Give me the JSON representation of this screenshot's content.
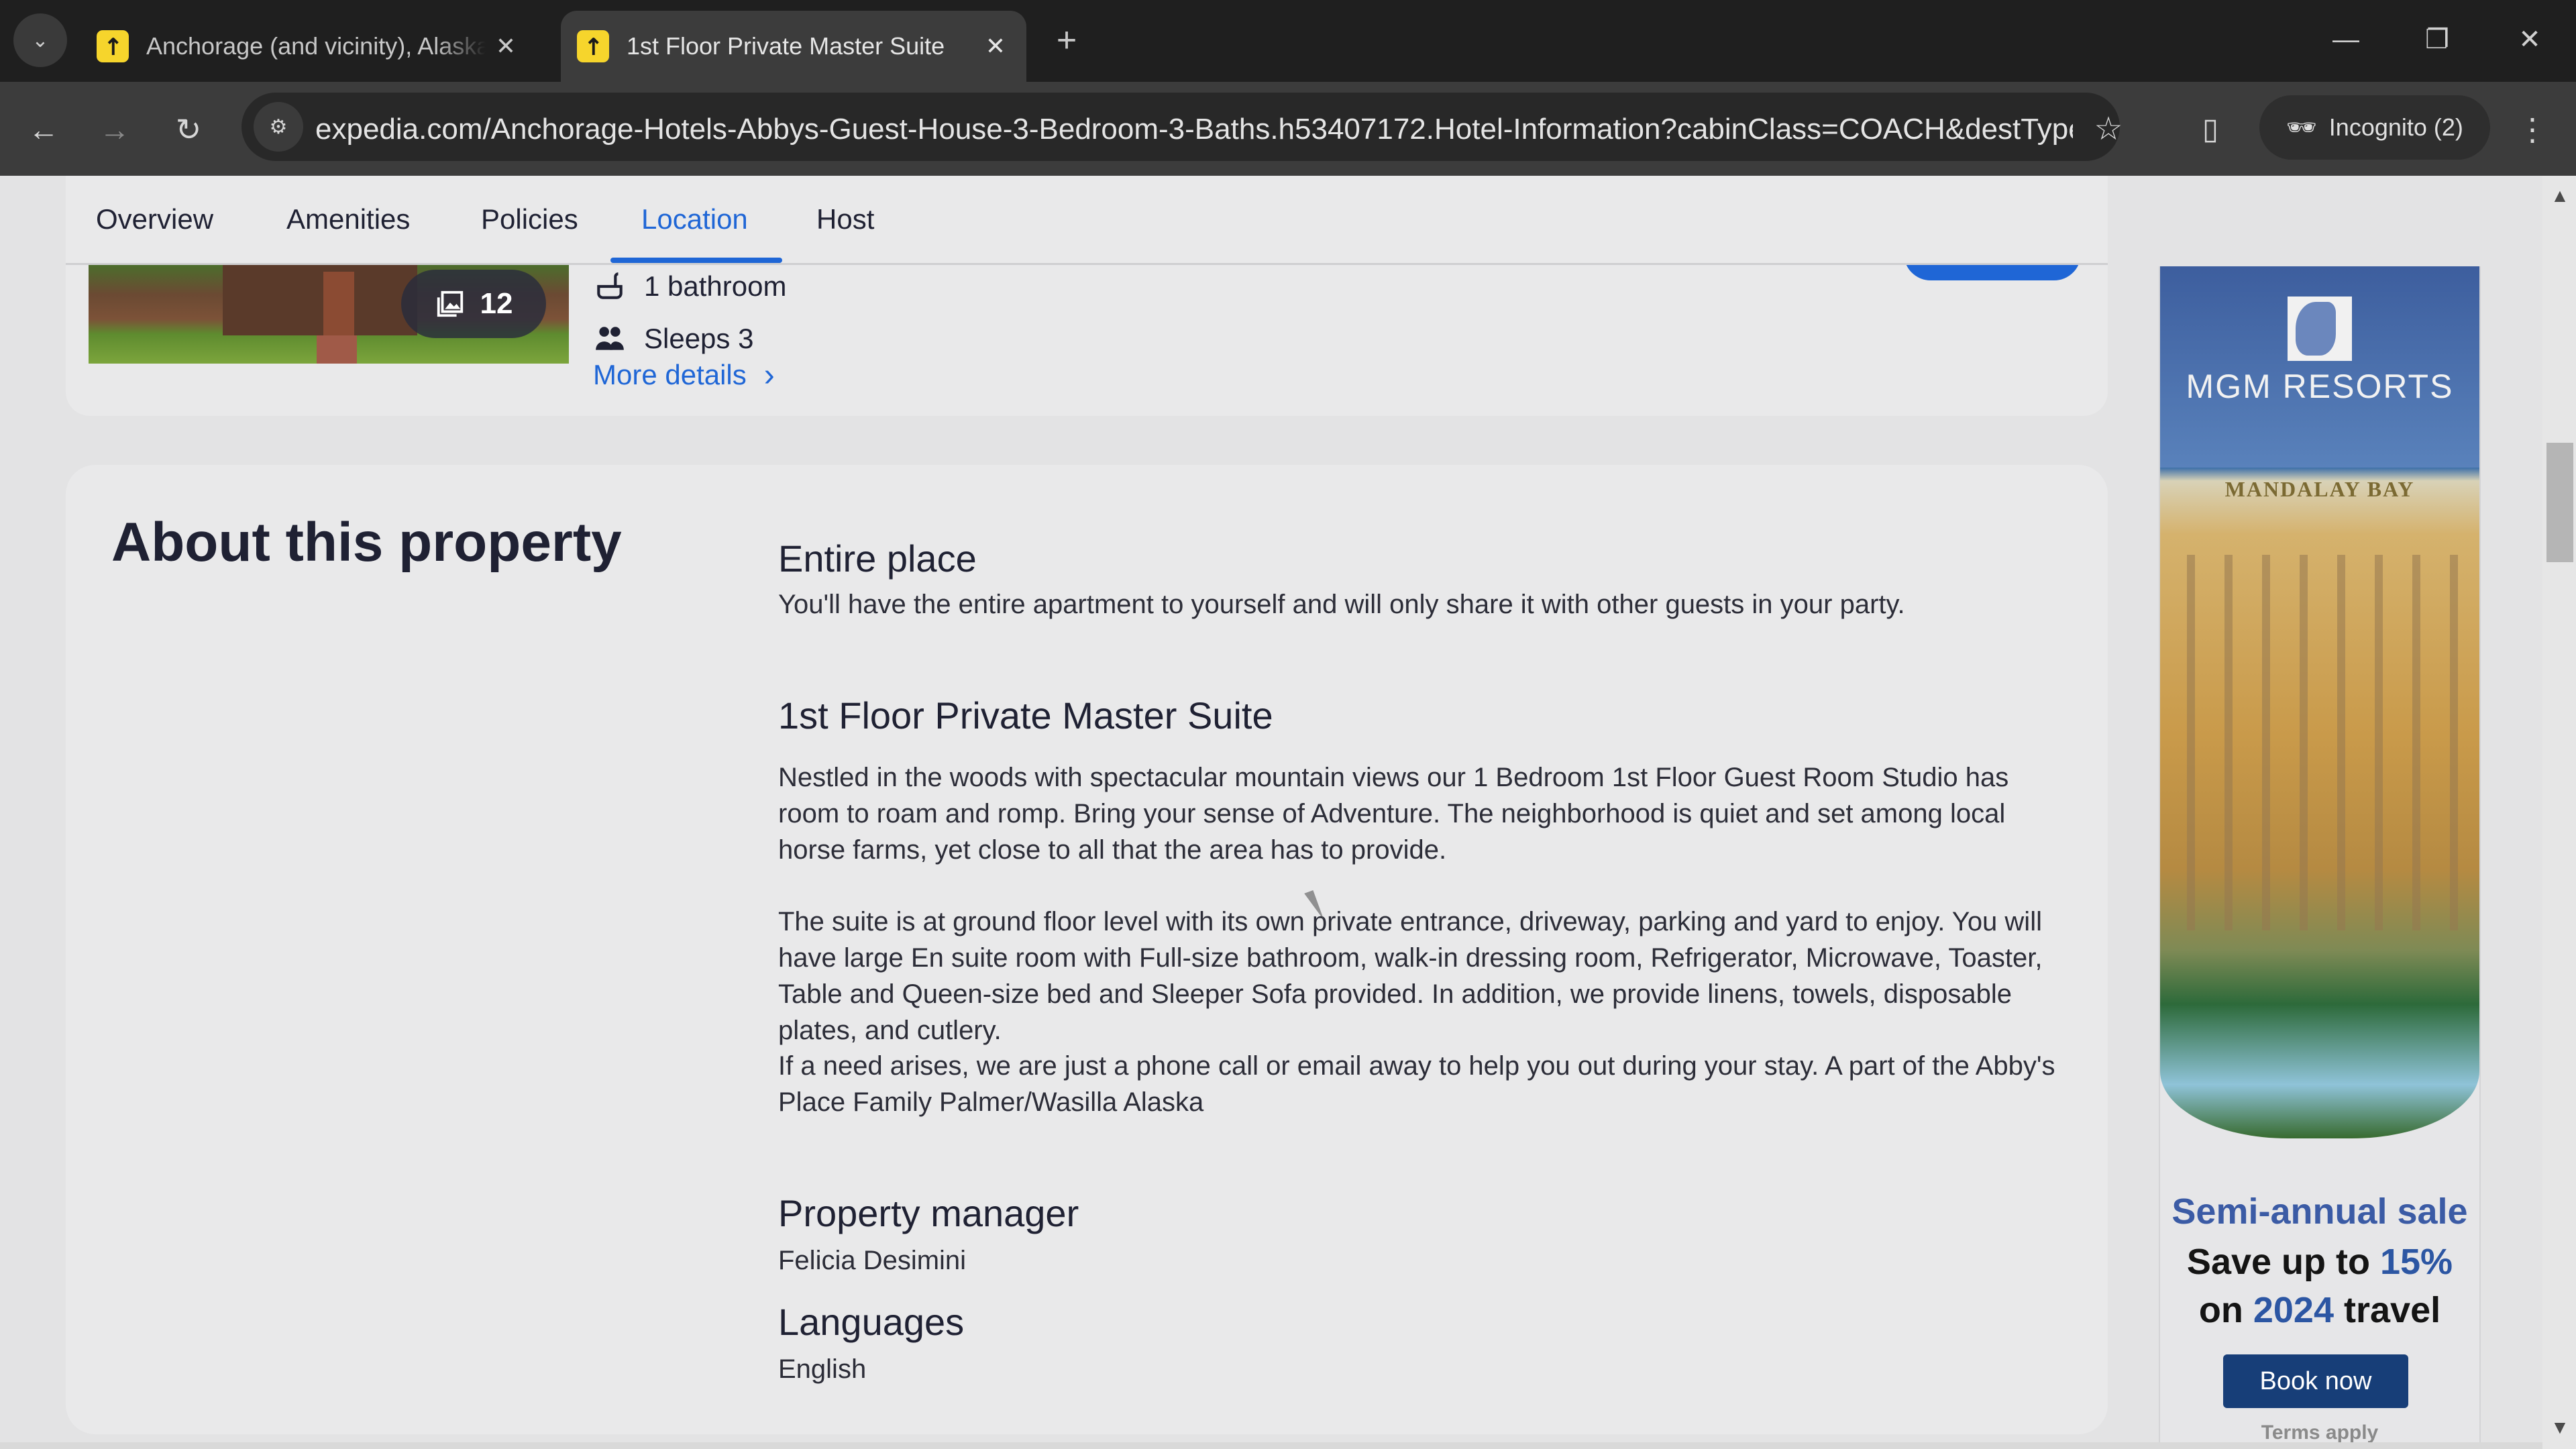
{
  "browser": {
    "tabs": [
      {
        "title": "Anchorage (and vicinity), Alaska",
        "active": false,
        "favicon": "expedia-icon"
      },
      {
        "title": "1st Floor Private Master Suite",
        "active": true,
        "favicon": "expedia-icon"
      }
    ],
    "icons": {
      "tab_list": "⌄",
      "tab_close": "✕",
      "new_tab": "+",
      "minimize": "—",
      "restore": "❐",
      "close": "✕",
      "back": "←",
      "forward": "→",
      "reload": "↻",
      "site_info": "⚙",
      "star": "☆",
      "side_panel": "▯",
      "incognito": "🕶",
      "menu": "⋮",
      "favicon": "↗"
    },
    "url": "expedia.com/Anchorage-Hotels-Abbys-Guest-House-3-Bedroom-3-Baths.h53407172.Hotel-Information?cabinClass=COACH&destType=MA...",
    "incognito_label": "Incognito (2)"
  },
  "subnav": {
    "items": [
      {
        "label": "Overview",
        "active": false
      },
      {
        "label": "Amenities",
        "active": false
      },
      {
        "label": "Policies",
        "active": false
      },
      {
        "label": "Location",
        "active": true
      },
      {
        "label": "Host",
        "active": false
      }
    ]
  },
  "summary": {
    "photo_count": "12",
    "bathrooms": "1 bathroom",
    "sleeps": "Sleeps 3",
    "more_details": "More details",
    "icons": {
      "bath": "bathtub-icon",
      "people": "people-icon",
      "gallery": "gallery-icon",
      "chevron": "›"
    }
  },
  "about": {
    "title": "About this property",
    "sections": [
      {
        "heading": "Entire place",
        "body": "You'll have the entire apartment to yourself and will only share it with other guests in your party."
      },
      {
        "heading": "1st Floor Private Master Suite",
        "paragraphs": [
          "Nestled in the woods with spectacular mountain views our 1 Bedroom 1st Floor Guest Room Studio has room to roam and romp. Bring your sense of Adventure. The neighborhood is quiet and set among local horse farms, yet close to all that the area has to provide.",
          "The suite is at ground floor level with its own private entrance, driveway, parking and yard to enjoy. You will have large En suite room with Full-size bathroom, walk-in dressing room, Refrigerator, Microwave, Toaster, Table and Queen-size bed and Sleeper Sofa provided. In addition, we provide linens, towels, disposable plates, and cutlery.",
          "If a need arises, we are just a phone call or email away to help you out during your stay. A part of the Abby's Place Family Palmer/Wasilla Alaska"
        ]
      },
      {
        "heading": "Property manager",
        "body": "Felicia Desimini"
      },
      {
        "heading": "Languages",
        "body": "English"
      }
    ]
  },
  "ad": {
    "brand": "MGM RESORTS",
    "photo_sign": "MANDALAY BAY",
    "headline": "Semi-annual sale",
    "line1_prefix": "Save up to ",
    "line1_highlight": "15%",
    "line2_prefix": "on ",
    "line2_highlight": "2024",
    "line2_suffix": " travel",
    "button": "Book now",
    "terms": "Terms apply"
  },
  "colors": {
    "accent": "#1f66d6",
    "text": "#1f2133",
    "ad_blue": "#3b5ba5",
    "ad_button": "#173e78"
  },
  "scrollbar": {
    "up": "▲",
    "down": "▼"
  }
}
